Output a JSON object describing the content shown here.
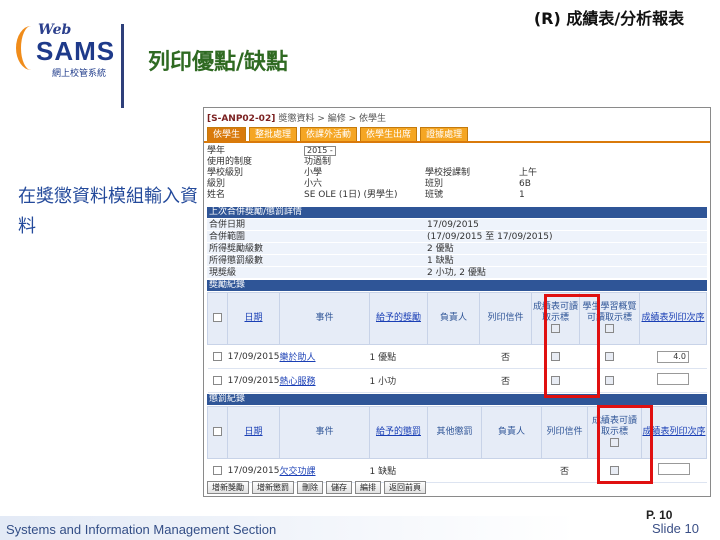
{
  "slide": {
    "logo_web": "Web",
    "logo_sams": "SAMS",
    "logo_sub": "網上校管系統",
    "title": "列印優點/缺點",
    "right_title": "(R) 成績表/分析報表",
    "side_text": "在獎懲資料模組輸入資料",
    "footer": "Systems and Information Management Section",
    "page_no": "P. 10",
    "slide_no": "Slide 10"
  },
  "colors": {
    "tab": "#f5a623",
    "section": "#2f5597",
    "highlight": "#e01010",
    "title": "#2f6a22"
  },
  "app": {
    "breadcrumb_code": "[S-ANP02-02]",
    "breadcrumb_path": "獎懲資料 > 編修 > 依學生",
    "tabs": [
      "依學生",
      "整批處理",
      "依課外活動",
      "依學生出席",
      "證據處理"
    ],
    "info": [
      {
        "l": "學年",
        "v": "2015 -"
      },
      {
        "l": "使用的制度",
        "v": "功過制"
      },
      {
        "l": "學校級別",
        "v": "小學",
        "l2": "學校授課制",
        "v2": "上午"
      },
      {
        "l": "級別",
        "v": "小六",
        "l2": "班別",
        "v2": "6B"
      },
      {
        "l": "姓名",
        "v": "SE OLE (1日) (男學生)",
        "l2": "班號",
        "v2": "1"
      }
    ],
    "sec1": "上次合併獎勵/懲罰詳情",
    "dates": [
      {
        "l": "合併日期",
        "v": "17/09/2015"
      },
      {
        "l": "合併範圍",
        "v": "(17/09/2015 至 17/09/2015)"
      },
      {
        "l": "所得獎勵級數",
        "v": "2 優點"
      },
      {
        "l": "所得懲罰級數",
        "v": "1 缺點"
      },
      {
        "l": "現獎級",
        "v": "2 小功, 2 優點"
      }
    ],
    "sec2": "獎勵紀錄",
    "t1_headers": [
      "日期",
      "事件",
      "給予的獎勵",
      "負責人",
      "列印信件",
      "成績表可讀取示標",
      "學生學習概覽可讀取示標",
      "成績表列印次序"
    ],
    "t1_rows": [
      {
        "date": "17/09/2015",
        "event": "樂於助人",
        "award": "1 優點",
        "print": "否",
        "val": "4.0"
      },
      {
        "date": "17/09/2015",
        "event": "熱心服務",
        "award": "1 小功",
        "print": "否",
        "val": ""
      }
    ],
    "sec3": "懲罰紀錄",
    "t2_headers": [
      "日期",
      "事件",
      "給予的懲罰",
      "其他懲罰",
      "負責人",
      "列印信件",
      "成績表可讀取示標",
      "成績表列印次序"
    ],
    "t2_rows": [
      {
        "date": "17/09/2015",
        "event": "欠交功課",
        "award": "1 缺點",
        "print": "否",
        "val": ""
      }
    ],
    "buttons": [
      "增新獎勵",
      "增新懲罰",
      "刪除",
      "儲存",
      "編排",
      "返回前頁"
    ]
  }
}
